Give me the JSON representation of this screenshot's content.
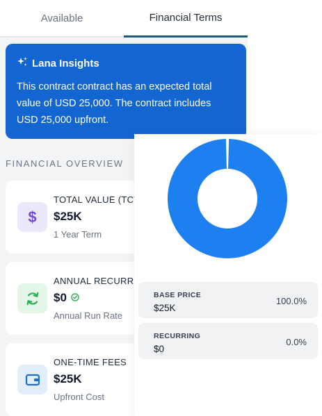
{
  "tabs": [
    {
      "label": "Available",
      "active": false
    },
    {
      "label": "Financial Terms",
      "active": true
    }
  ],
  "insights": {
    "title": "Lana Insights",
    "icon": "sparkles-icon",
    "text": "This contract contract has an expected total value of USD 25,000. The contract includes USD 25,000 upfront."
  },
  "overview": {
    "title": "FINANCIAL OVERVIEW",
    "cards": [
      {
        "label": "TOTAL VALUE (TCV)",
        "value": "$25K",
        "sub": "1 Year Term",
        "icon": "dollar-icon"
      },
      {
        "label": "ANNUAL RECURRING",
        "value": "$0",
        "sub": "Annual Run Rate",
        "icon": "refresh-icon"
      },
      {
        "label": "ONE-TIME FEES",
        "value": "$25K",
        "sub": "Upfront Cost",
        "icon": "wallet-icon"
      }
    ]
  },
  "breakdown": [
    {
      "label": "BASE PRICE",
      "value": "$25K",
      "percent": "100.0%"
    },
    {
      "label": "RECURRING",
      "value": "$0",
      "percent": "0.0%"
    }
  ],
  "chart_data": {
    "type": "pie",
    "categories": [
      "BASE PRICE",
      "RECURRING"
    ],
    "values": [
      100.0,
      0.0
    ],
    "colors": [
      "#1e7ff0",
      "#9aa7b8"
    ]
  },
  "colors": {
    "accent": "#1366d2",
    "tab_underline": "#1e5b79",
    "donut": "#1e7ff0"
  }
}
